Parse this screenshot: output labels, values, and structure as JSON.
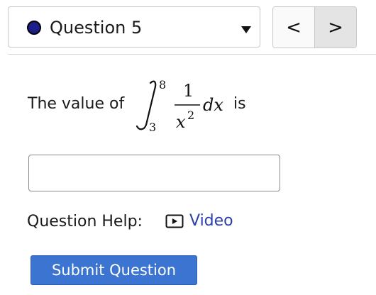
{
  "question_selector": {
    "label": "Question 5",
    "status_color": "#1c1e8a",
    "dropdown_icon": "caret-down-icon"
  },
  "navigation": {
    "prev_symbol": "<",
    "next_symbol": ">",
    "prev_icon": "chevron-left-icon",
    "next_icon": "chevron-right-icon"
  },
  "question": {
    "text_before": "The value of",
    "text_after": "is",
    "integral": {
      "lower_limit": "3",
      "upper_limit": "8",
      "numerator": "1",
      "denominator_base": "x",
      "denominator_exponent": "2",
      "differential": "dx"
    }
  },
  "answer": {
    "value": "",
    "placeholder": ""
  },
  "help": {
    "label": "Question Help:",
    "video_label": "Video",
    "video_icon": "play-video-icon",
    "link_color": "#2b3fa8"
  },
  "submit": {
    "label": "Submit Question",
    "color": "#3b74d1"
  }
}
